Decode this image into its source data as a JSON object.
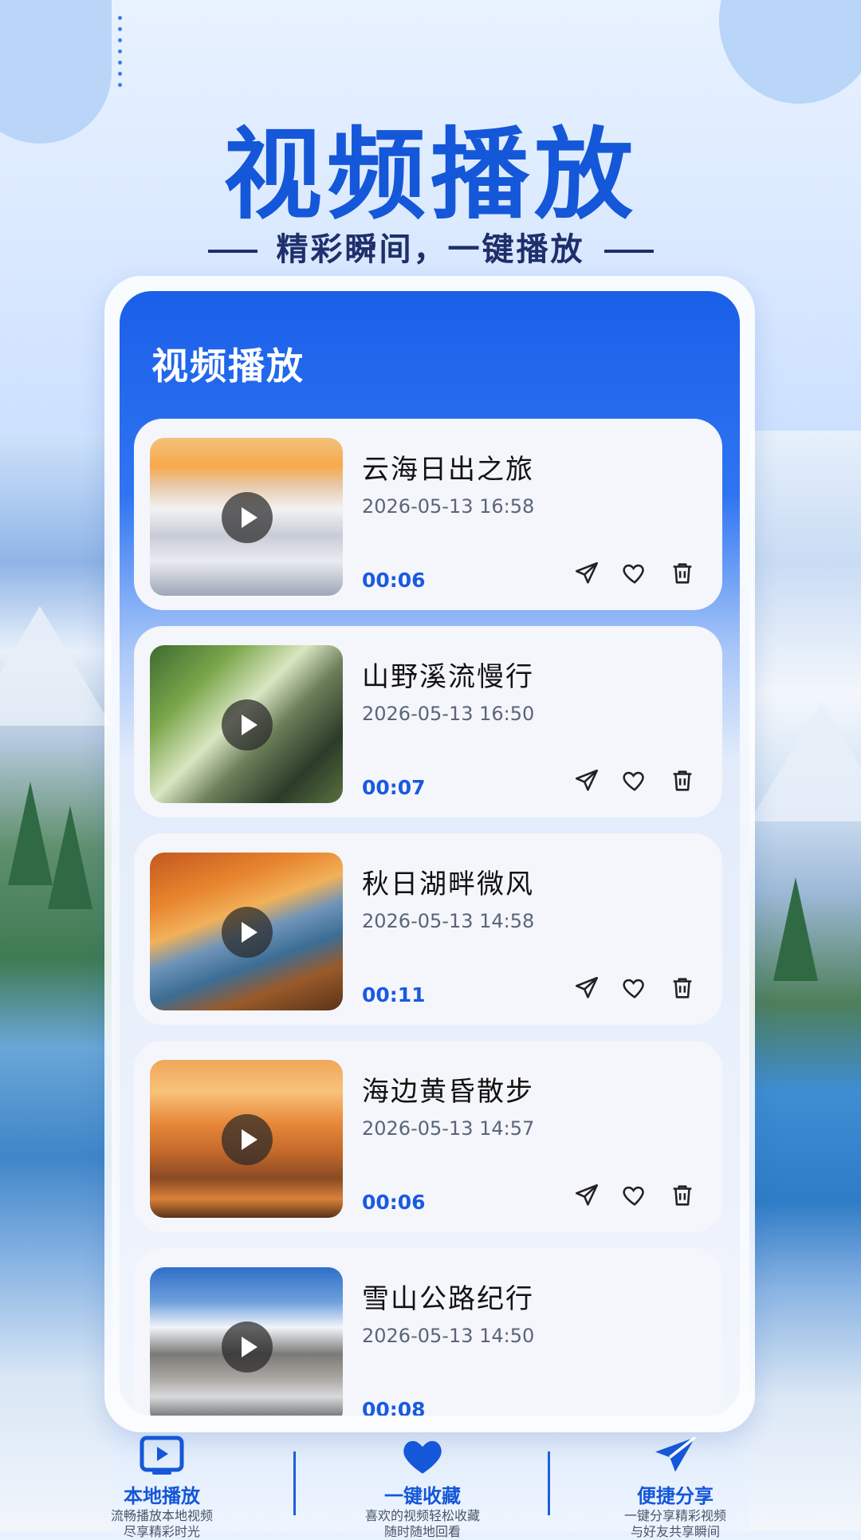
{
  "hero": {
    "title": "视频播放",
    "subtitle": "精彩瞬间，一键播放"
  },
  "panel": {
    "title": "视频播放"
  },
  "videos": [
    {
      "title": "云海日出之旅",
      "date": "2026-05-13 16:58",
      "duration": "00:06"
    },
    {
      "title": "山野溪流慢行",
      "date": "2026-05-13 16:50",
      "duration": "00:07"
    },
    {
      "title": "秋日湖畔微风",
      "date": "2026-05-13 14:58",
      "duration": "00:11"
    },
    {
      "title": "海边黄昏散步",
      "date": "2026-05-13 14:57",
      "duration": "00:06"
    },
    {
      "title": "雪山公路纪行",
      "date": "2026-05-13 14:50",
      "duration": "00:08"
    }
  ],
  "features": [
    {
      "label": "本地播放",
      "line1": "流畅播放本地视频",
      "line2": "尽享精彩时光",
      "icon": "play-screen-icon"
    },
    {
      "label": "一键收藏",
      "line1": "喜欢的视频轻松收藏",
      "line2": "随时随地回看",
      "icon": "heart-icon"
    },
    {
      "label": "便捷分享",
      "line1": "一键分享精彩视频",
      "line2": "与好友共享瞬间",
      "icon": "paper-plane-icon"
    }
  ],
  "colors": {
    "brand": "#1457d8",
    "accent": "#1a5ae0",
    "panel_top": "#1a5fe8"
  }
}
